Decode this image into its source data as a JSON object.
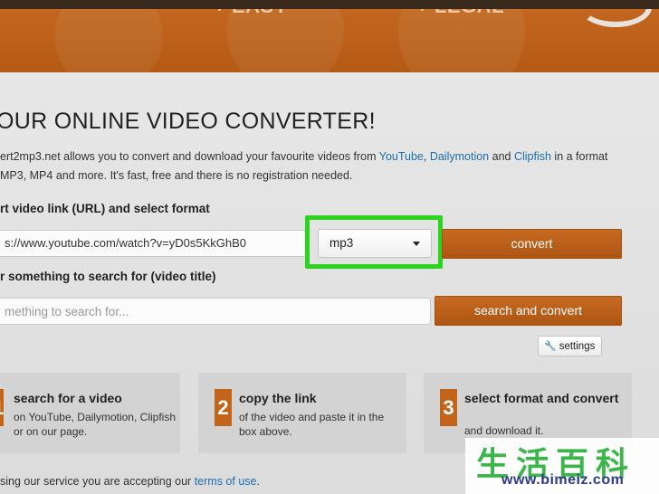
{
  "banner": {
    "tag_easy": "+ EASY",
    "tag_legal": "+ LEGAL"
  },
  "title": "OUR ONLINE VIDEO CONVERTER!",
  "intro": {
    "part1": "ert2mp3.net allows you to convert and download your favourite videos from ",
    "link_youtube": "YouTube",
    "sep1": ", ",
    "link_dailymotion": "Dailymotion",
    "sep2": " and ",
    "link_clipfish": "Clipfish",
    "part2": " in a format",
    "line2": "MP3, MP4 and more. It's fast, free and there is no registration needed."
  },
  "url_section": {
    "label": "rt video link (URL) and select format",
    "url_value": "s://www.youtube.com/watch?v=yD0s5KkGhB0",
    "format_selected": "mp3",
    "convert_label": "convert"
  },
  "search_section": {
    "label": "r something to search for (video title)",
    "placeholder": "mething to search for...",
    "button_label": "search and convert"
  },
  "settings_label": "settings",
  "steps": [
    {
      "number": "1",
      "title": "search for a video",
      "desc": "on YouTube, Dailymotion, Clipfish or on our page."
    },
    {
      "number": "2",
      "title": "copy the link",
      "desc": "of the video and paste it in the box above."
    },
    {
      "number": "3",
      "title": "select format and convert",
      "desc": "and download it."
    }
  ],
  "footer": {
    "text": "sing our service you are accepting our ",
    "link": "terms of use",
    "end": "."
  },
  "watermark": {
    "chars": "生活百科",
    "url": "www.bimeiz.com"
  },
  "colors": {
    "accent_orange": "#b85b17",
    "highlight_green": "#2bd51d",
    "link_blue": "#1a6fb0"
  }
}
